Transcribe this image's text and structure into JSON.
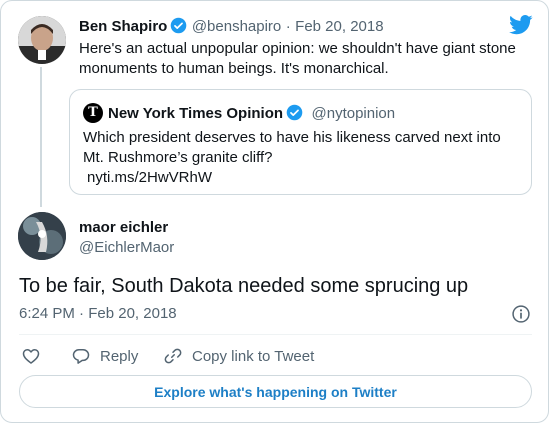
{
  "original_tweet": {
    "author_name": "Ben Shapiro",
    "handle": "@benshapiro",
    "separator": "·",
    "date": "Feb 20, 2018",
    "text_line1": "Here's an actual unpopular opinion: we shouldn't have giant stone",
    "text_line2": "monuments to human beings. It's monarchical."
  },
  "quoted_tweet": {
    "author_name": "New York Times Opinion",
    "handle": "@nytopinion",
    "logo_letter": "T",
    "text_line1": "Which president deserves to have his likeness carved next into",
    "text_line2": "Mt. Rushmore’s granite cliff?",
    "link": "nyti.ms/2HwVRhW"
  },
  "reply_tweet": {
    "author_name": "maor eichler",
    "handle": "@EichlerMaor",
    "text": "To be fair, South Dakota needed some sprucing up",
    "time": "6:24 PM",
    "separator": "·",
    "date": "Feb 20, 2018"
  },
  "actions": {
    "reply_label": "Reply",
    "copy_link_label": "Copy link to Tweet"
  },
  "explore_label": "Explore what's happening on Twitter",
  "colors": {
    "twitter_blue": "#1d9bf0",
    "link_blue": "#1d7fc6",
    "muted_gray": "#536471",
    "border_gray": "#cfd9de"
  }
}
